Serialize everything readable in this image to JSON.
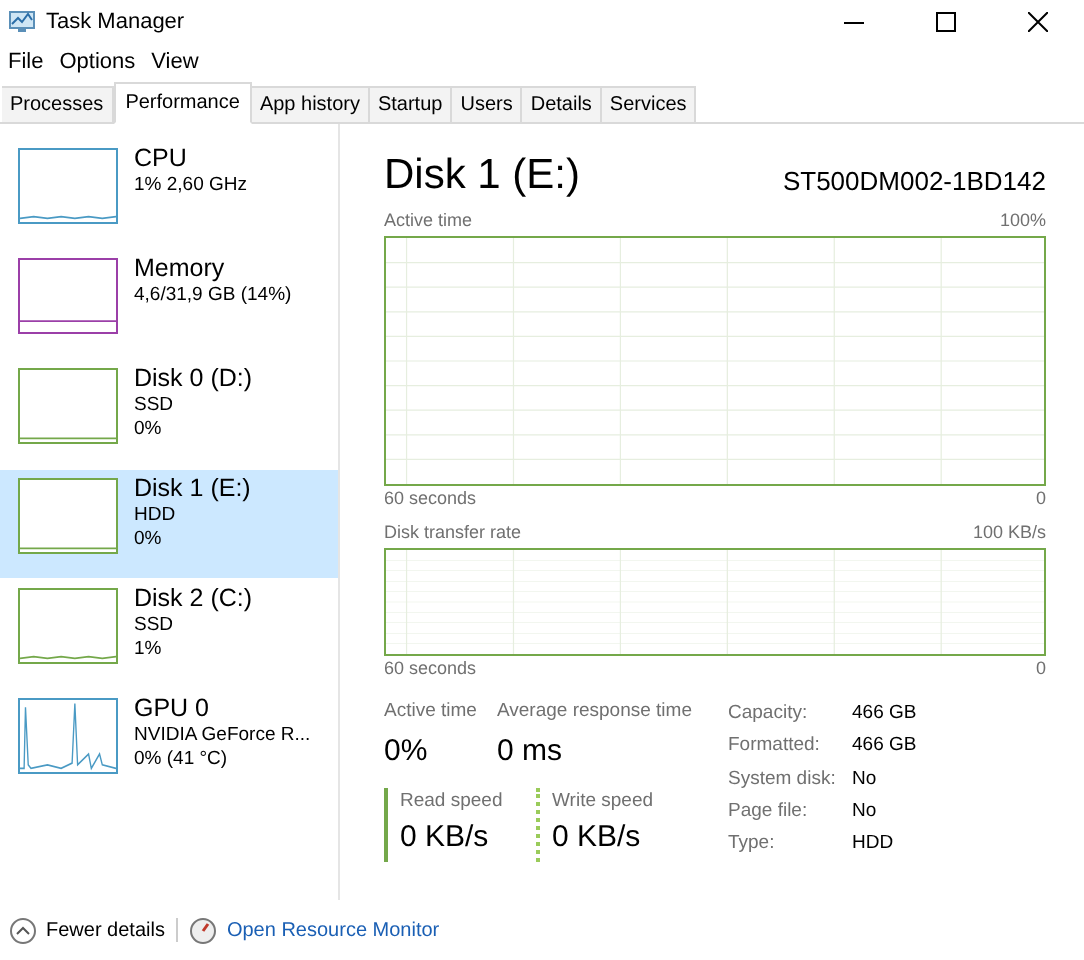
{
  "window": {
    "title": "Task Manager"
  },
  "menu": [
    "File",
    "Options",
    "View"
  ],
  "tabs": [
    {
      "label": "Processes",
      "selected": false
    },
    {
      "label": "Performance",
      "selected": true
    },
    {
      "label": "App history",
      "selected": false
    },
    {
      "label": "Startup",
      "selected": false
    },
    {
      "label": "Users",
      "selected": false
    },
    {
      "label": "Details",
      "selected": false
    },
    {
      "label": "Services",
      "selected": false
    }
  ],
  "sidebar": {
    "items": [
      {
        "name": "CPU",
        "lines": [
          "1% 2,60 GHz"
        ],
        "color": "#4a9ac4",
        "selected": false
      },
      {
        "name": "Memory",
        "lines": [
          "4,6/31,9 GB (14%)"
        ],
        "color": "#9b3fa8",
        "selected": false
      },
      {
        "name": "Disk 0 (D:)",
        "lines": [
          "SSD",
          "0%"
        ],
        "color": "#74a84a",
        "selected": false
      },
      {
        "name": "Disk 1 (E:)",
        "lines": [
          "HDD",
          "0%"
        ],
        "color": "#74a84a",
        "selected": true
      },
      {
        "name": "Disk 2 (C:)",
        "lines": [
          "SSD",
          "1%"
        ],
        "color": "#74a84a",
        "selected": false
      },
      {
        "name": "GPU 0",
        "lines": [
          "NVIDIA GeForce R...",
          "0% (41 °C)"
        ],
        "color": "#4a9ac4",
        "selected": false
      }
    ]
  },
  "detail": {
    "title": "Disk 1 (E:)",
    "model": "ST500DM002-1BD142",
    "graphs": [
      {
        "label": "Active time",
        "max": "100%",
        "span": "60 seconds",
        "min": "0",
        "kind": "tall"
      },
      {
        "label": "Disk transfer rate",
        "max": "100 KB/s",
        "span": "60 seconds",
        "min": "0",
        "kind": "short"
      }
    ],
    "stats": [
      {
        "label": "Active time",
        "value": "0%"
      },
      {
        "label": "Average response time",
        "value": "0 ms"
      }
    ],
    "speeds": [
      {
        "label": "Read speed",
        "value": "0 KB/s",
        "kind": "solid"
      },
      {
        "label": "Write speed",
        "value": "0 KB/s",
        "kind": "dotted"
      }
    ],
    "properties": [
      {
        "label": "Capacity:",
        "value": "466 GB"
      },
      {
        "label": "Formatted:",
        "value": "466 GB"
      },
      {
        "label": "System disk:",
        "value": "No"
      },
      {
        "label": "Page file:",
        "value": "No"
      },
      {
        "label": "Type:",
        "value": "HDD"
      }
    ]
  },
  "footer": {
    "fewer": "Fewer details",
    "monitor": "Open Resource Monitor"
  }
}
